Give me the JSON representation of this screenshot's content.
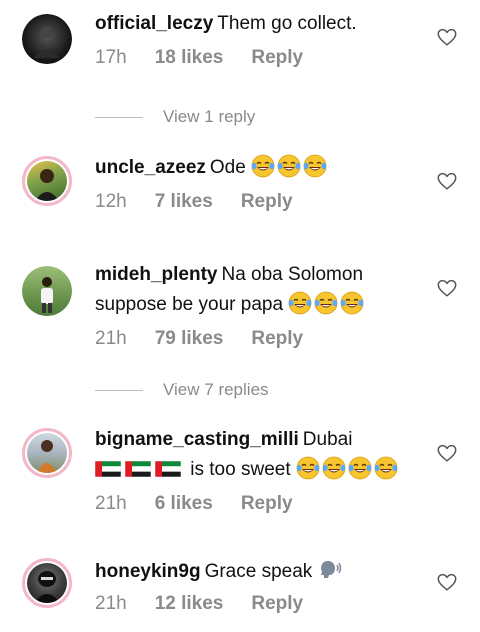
{
  "comments": [
    {
      "username": "official_leczy",
      "text": "Them go collect.",
      "time": "17h",
      "likes": "18 likes",
      "reply": "Reply"
    },
    {
      "username": "uncle_azeez",
      "text": "Ode",
      "time": "12h",
      "likes": "7 likes",
      "reply": "Reply"
    },
    {
      "username": "mideh_plenty",
      "text": "Na oba Solomon suppose be your papa",
      "time": "21h",
      "likes": "79 likes",
      "reply": "Reply"
    },
    {
      "username": "bigname_casting_milli",
      "text": "Dubai",
      "text2": "is too sweet",
      "time": "21h",
      "likes": "6 likes",
      "reply": "Reply"
    },
    {
      "username": "honeykin9g",
      "text": "Grace speak",
      "time": "21h",
      "likes": "12 likes",
      "reply": "Reply"
    }
  ],
  "view_replies": [
    "View 1 reply",
    "View 7 replies"
  ],
  "icons": {
    "like": "heart-outline-icon",
    "laugh": "tears-of-joy-emoji",
    "flag": "uae-flag-emoji",
    "speak": "speaking-head-emoji"
  }
}
